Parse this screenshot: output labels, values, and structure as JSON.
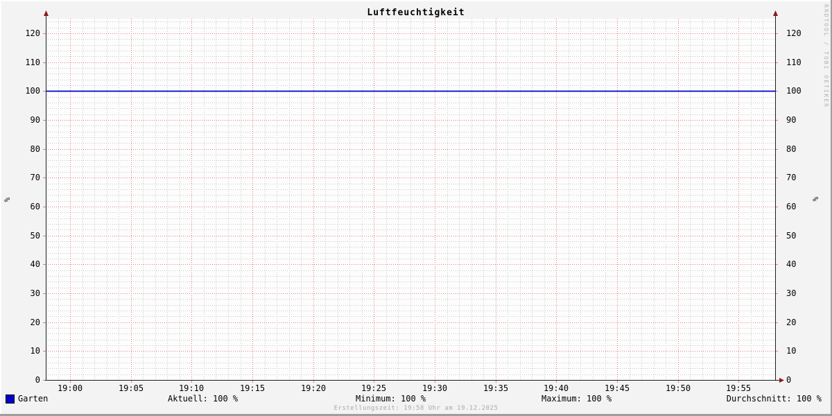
{
  "title": "Luftfeuchtigkeit",
  "y_axis_unit": "%",
  "watermark": "RRDTOOL / TOBI OETIKER",
  "footer": "Erstellungszeit: 19:58 Uhr am 19.12.2025",
  "legend": {
    "series_label": "Garten",
    "aktuell": "Aktuell: 100 %",
    "minimum": "Minimum: 100 %",
    "maximum": "Maximum: 100 %",
    "durchschnitt": "Durchschnitt: 100 %"
  },
  "colors": {
    "background": "#f3f3f3",
    "canvas": "#fdfdfd",
    "axis": "#1c1c1c",
    "arrow": "#8b1a1a",
    "major_grid": "#e07d7d",
    "minor_grid": "#c8c8c8",
    "series_line": "#0000d0",
    "swatch_border": "#000000"
  },
  "chart_data": {
    "type": "line",
    "title": "Luftfeuchtigkeit",
    "xlabel": "",
    "ylabel": "%",
    "ylim": [
      0,
      125
    ],
    "y_tick_step_major": 10,
    "y_tick_step_minor": 2,
    "y_tick_values": [
      0,
      10,
      20,
      30,
      40,
      50,
      60,
      70,
      80,
      90,
      100,
      110,
      120
    ],
    "x_range": [
      "18:58",
      "19:58"
    ],
    "x_total_minutes": 60,
    "x_first_major_tick_minute": 2,
    "x_tick_interval_minutes": 5,
    "x_minor_tick_interval_minutes": 1,
    "x_tick_labels": [
      "19:00",
      "19:05",
      "19:10",
      "19:15",
      "19:20",
      "19:25",
      "19:30",
      "19:35",
      "19:40",
      "19:45",
      "19:50",
      "19:55"
    ],
    "grid": true,
    "legend_position": "bottom",
    "series": [
      {
        "name": "Garten",
        "color": "#0000d0",
        "constant_value": 100
      }
    ],
    "stats": {
      "aktuell": "100 %",
      "minimum": "100 %",
      "maximum": "100 %",
      "durchschnitt": "100 %"
    }
  }
}
